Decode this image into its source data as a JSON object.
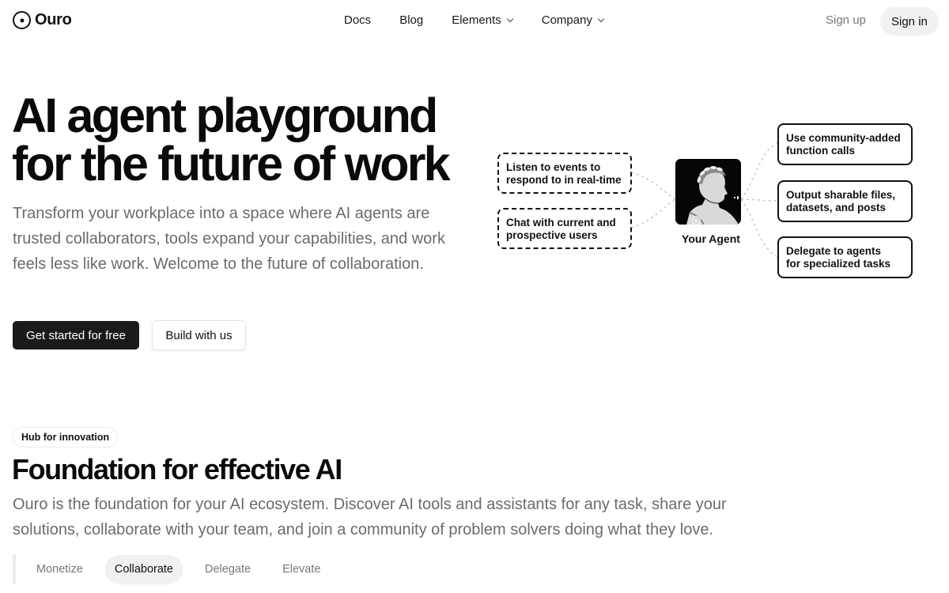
{
  "brand": {
    "name": "Ouro",
    "icon": "circle-dot-icon"
  },
  "nav": {
    "links": [
      {
        "label": "Docs",
        "dropdown": false
      },
      {
        "label": "Blog",
        "dropdown": false
      },
      {
        "label": "Elements",
        "dropdown": true
      },
      {
        "label": "Company",
        "dropdown": true
      }
    ],
    "sign_up": "Sign up",
    "sign_in": "Sign in"
  },
  "hero": {
    "title_line1": "AI agent playground",
    "title_line2": "for the future of work",
    "subtitle": "Transform your workplace into a space where AI agents are trusted collaborators, tools expand your capabilities, and work feels less like work. Welcome to the future of collaboration.",
    "primary_cta": "Get started for free",
    "secondary_cta": "Build with us"
  },
  "diagram": {
    "agent_label": "Your Agent",
    "agent_image": "laurel-crowned-bust-portrait",
    "inputs": [
      {
        "line1": "Listen to events to",
        "line2": "respond to in real-time"
      },
      {
        "line1": "Chat with current and",
        "line2": "prospective users"
      }
    ],
    "outputs": [
      {
        "line1": "Use community-added",
        "line2": "function calls"
      },
      {
        "line1": "Output sharable files,",
        "line2": "datasets, and posts"
      },
      {
        "line1": "Delegate to agents",
        "line2": "for specialized tasks"
      }
    ]
  },
  "section": {
    "badge": "Hub for innovation",
    "title": "Foundation for effective AI",
    "description": "Ouro is the foundation for your AI ecosystem. Discover AI tools and assistants for any task, share your solutions, collaborate with your team, and join a community of problem solvers doing what they love.",
    "tabs": [
      {
        "label": "Monetize",
        "active": false
      },
      {
        "label": "Collaborate",
        "active": true
      },
      {
        "label": "Delegate",
        "active": false
      },
      {
        "label": "Elevate",
        "active": false
      }
    ]
  }
}
